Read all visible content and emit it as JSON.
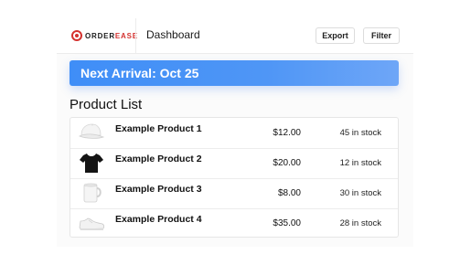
{
  "header": {
    "logo_part1": "ORDER",
    "logo_part2": "EASE",
    "title": "Dashboard",
    "export_label": "Export",
    "filter_label": "Filter"
  },
  "banner": {
    "text": "Next Arrival: Oct 25",
    "color": "#4a90f5"
  },
  "product_list": {
    "title": "Product List",
    "items": [
      {
        "name": "Example Product 1",
        "price": "$12.00",
        "stock": "45 in stock",
        "image": "white-cap-icon"
      },
      {
        "name": "Example Product 2",
        "price": "$20.00",
        "stock": "12 in stock",
        "image": "black-tshirt-icon"
      },
      {
        "name": "Example Product 3",
        "price": "$8.00",
        "stock": "30 in stock",
        "image": "white-mug-icon"
      },
      {
        "name": "Example Product 4",
        "price": "$35.00",
        "stock": "28 in stock",
        "image": "white-sneaker-icon"
      }
    ]
  },
  "colors": {
    "brand_red": "#d4322f",
    "accent_blue": "#4a90f5"
  }
}
